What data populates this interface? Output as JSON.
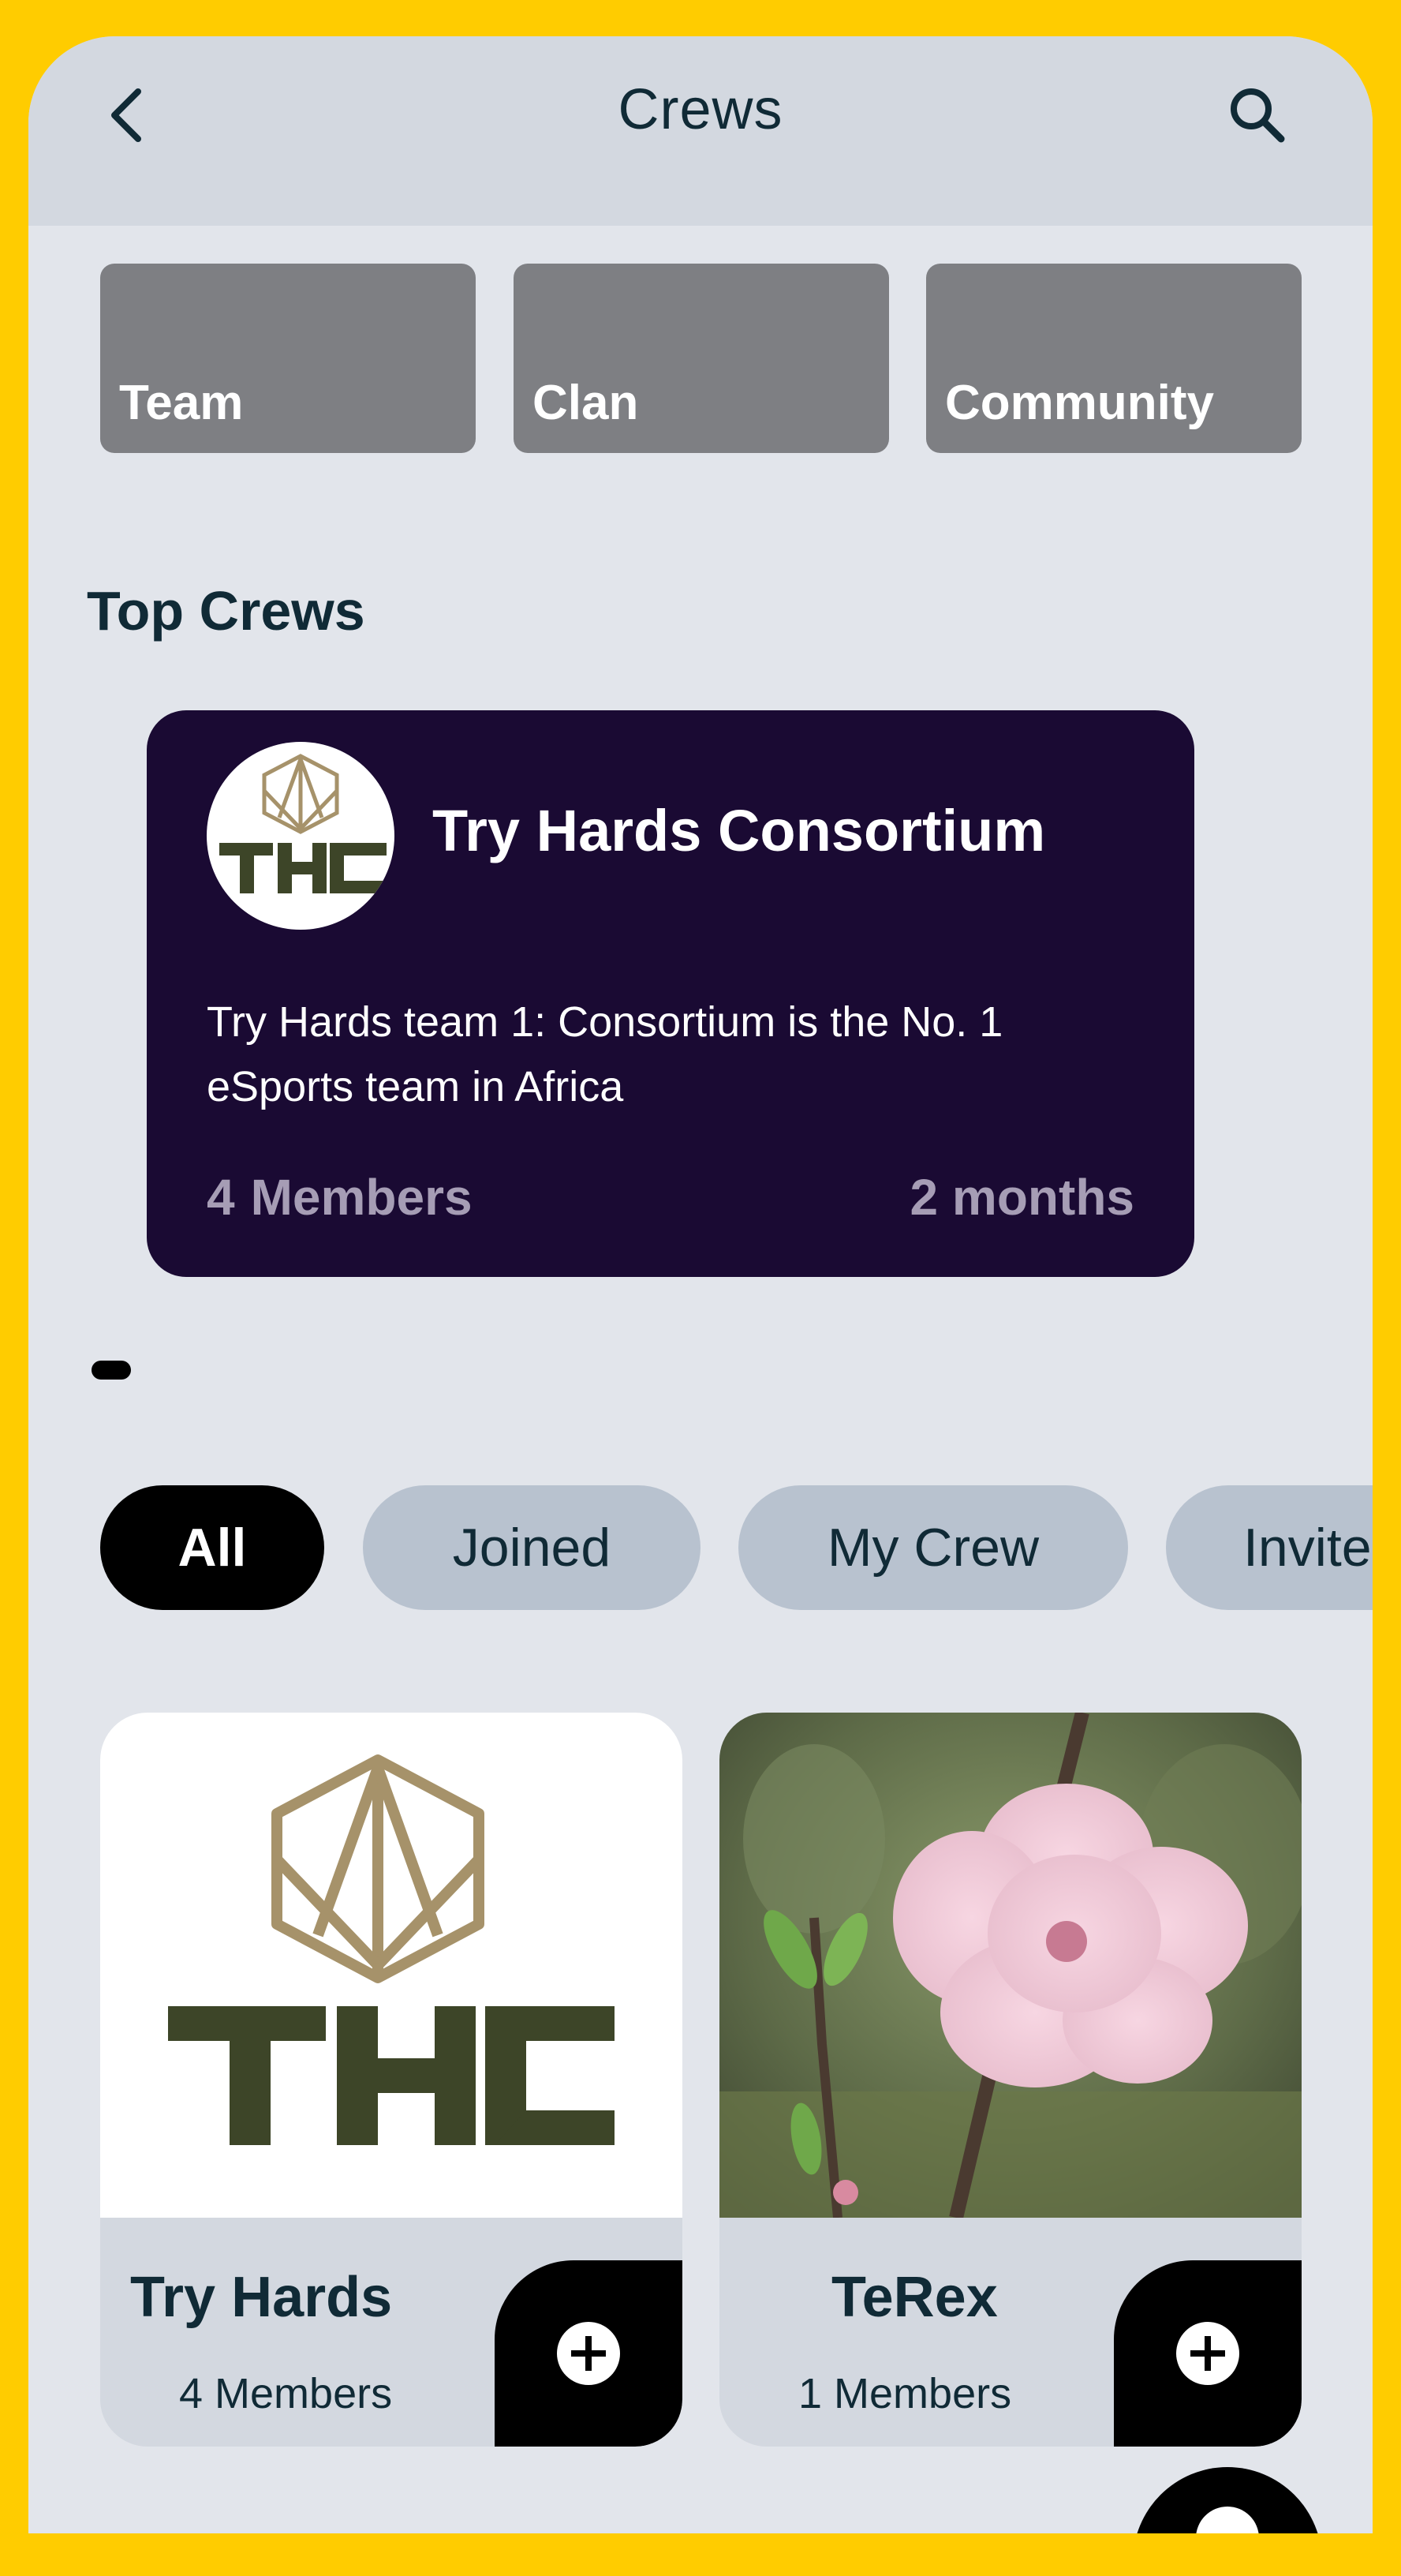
{
  "header": {
    "title": "Crews",
    "back_icon": "chevron-left-icon",
    "search_icon": "search-icon"
  },
  "categories": [
    {
      "label": "Team"
    },
    {
      "label": "Clan"
    },
    {
      "label": "Community"
    }
  ],
  "top_crews": {
    "section_title": "Top Crews",
    "card": {
      "logo_text": "THC",
      "name": "Try Hards Consortium",
      "description": "Try Hards team 1: Consortium is the No. 1 eSports team in Africa",
      "member_count": "4",
      "members_label": "Members",
      "age": "2 months"
    }
  },
  "filters": [
    {
      "label": "All",
      "active": true
    },
    {
      "label": "Joined",
      "active": false
    },
    {
      "label": "My Crew",
      "active": false
    },
    {
      "label": "Invite",
      "active": false
    }
  ],
  "crews": [
    {
      "name": "Try Hards",
      "members": "4 Members",
      "logo_text": "THC"
    },
    {
      "name": "TeRex",
      "members": "1 Members"
    }
  ],
  "colors": {
    "frame": "#FFCC00",
    "background": "#E2E5EB",
    "appbar": "#D3D8E0",
    "category_tile": "#7E7F83",
    "top_card": "#1A0A33",
    "chip_inactive": "#B8C2CF",
    "chip_active": "#000000",
    "thc_gold": "#A6926A",
    "thc_dark": "#3D4528"
  }
}
